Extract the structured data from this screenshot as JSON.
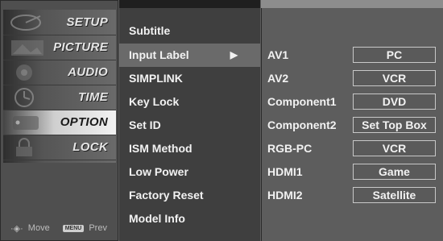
{
  "categories": [
    {
      "label": "SETUP",
      "icon": "satellite-dish-icon"
    },
    {
      "label": "PICTURE",
      "icon": "picture-icon"
    },
    {
      "label": "AUDIO",
      "icon": "speaker-icon"
    },
    {
      "label": "TIME",
      "icon": "clock-icon"
    },
    {
      "label": "OPTION",
      "icon": "option-tag-icon"
    },
    {
      "label": "LOCK",
      "icon": "lock-icon"
    }
  ],
  "active_category": "OPTION",
  "footer": {
    "move": "Move",
    "menu_key": "MENU",
    "prev": "Prev"
  },
  "options": [
    {
      "label": "Subtitle"
    },
    {
      "label": "Input Label",
      "arrow": "▶"
    },
    {
      "label": "SIMPLINK"
    },
    {
      "label": "Key Lock"
    },
    {
      "label": "Set ID"
    },
    {
      "label": "ISM Method"
    },
    {
      "label": "Low Power"
    },
    {
      "label": "Factory Reset"
    },
    {
      "label": "Model Info"
    }
  ],
  "selected_option": "Input Label",
  "input_labels": [
    {
      "source": "AV1",
      "label": "PC"
    },
    {
      "source": "AV2",
      "label": "VCR"
    },
    {
      "source": "Component1",
      "label": "DVD"
    },
    {
      "source": "Component2",
      "label": "Set Top Box"
    },
    {
      "source": "RGB-PC",
      "label": "VCR"
    },
    {
      "source": "HDMI1",
      "label": "Game"
    },
    {
      "source": "HDMI2",
      "label": "Satellite"
    }
  ]
}
